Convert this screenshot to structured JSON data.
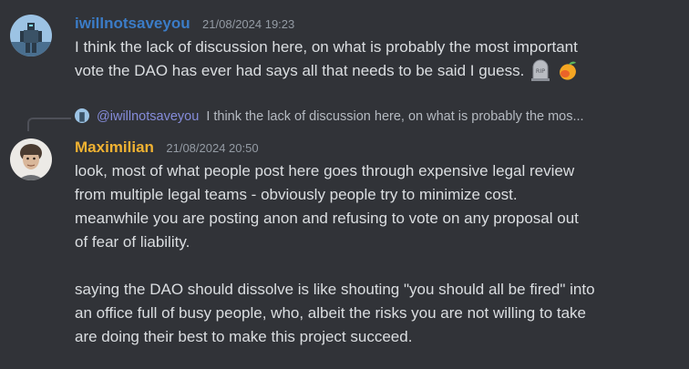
{
  "message1": {
    "username": "iwillnotsaveyou",
    "username_color": "#3b7cc7",
    "timestamp": "21/08/2024 19:23",
    "lines": [
      "I think the lack of discussion here, on what is probably the most important",
      "vote the DAO has ever had says all that needs to be said I guess."
    ],
    "emojis": [
      "rip-tombstone-icon",
      "mango-icon"
    ]
  },
  "reply": {
    "mention": "@iwillnotsaveyou",
    "preview": "I think the lack of discussion here, on what is probably the mos..."
  },
  "message2": {
    "username": "Maximilian",
    "username_color": "#f0b232",
    "timestamp": "21/08/2024 20:50",
    "lines": [
      "look, most of what people post here goes through expensive legal review",
      "from multiple legal teams - obviously people try to minimize cost.",
      "meanwhile you are posting anon and refusing to vote on any proposal out",
      "of fear of liability.",
      "",
      "saying the DAO should dissolve is like shouting \"you should all be fired\" into",
      "an office full of busy people, who, albeit the risks you are not willing to take",
      "are doing their best to make this project succeed."
    ]
  }
}
